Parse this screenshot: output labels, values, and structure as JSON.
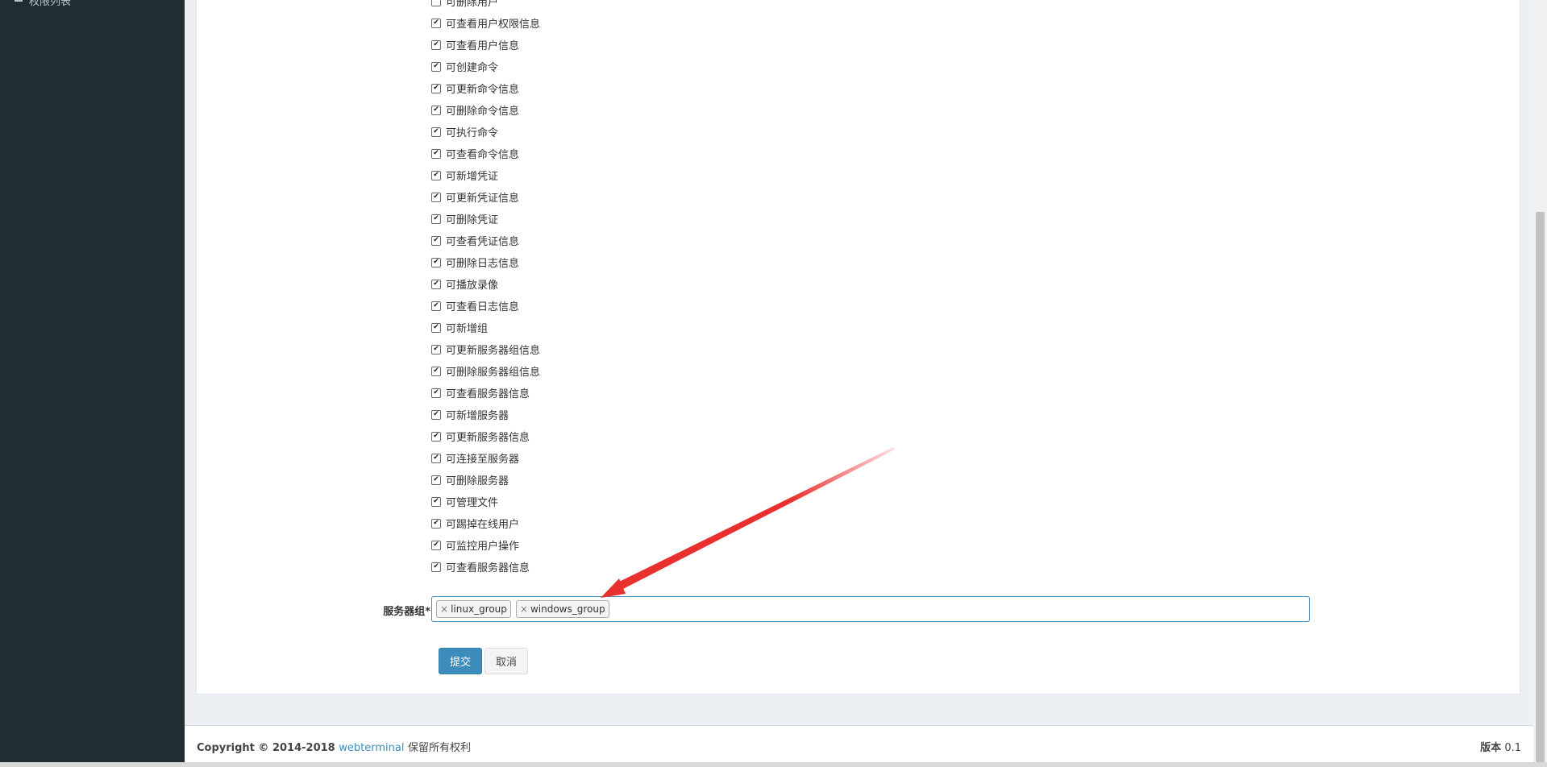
{
  "sidebar": {
    "items": [
      {
        "label": "权限列表"
      }
    ]
  },
  "permissions": [
    {
      "label": "可删除用户",
      "checked": false
    },
    {
      "label": "可查看用户权限信息",
      "checked": true
    },
    {
      "label": "可查看用户信息",
      "checked": true
    },
    {
      "label": "可创建命令",
      "checked": true
    },
    {
      "label": "可更新命令信息",
      "checked": true
    },
    {
      "label": "可删除命令信息",
      "checked": true
    },
    {
      "label": "可执行命令",
      "checked": true
    },
    {
      "label": "可查看命令信息",
      "checked": true
    },
    {
      "label": "可新增凭证",
      "checked": true
    },
    {
      "label": "可更新凭证信息",
      "checked": true
    },
    {
      "label": "可删除凭证",
      "checked": true
    },
    {
      "label": "可查看凭证信息",
      "checked": true
    },
    {
      "label": "可删除日志信息",
      "checked": true
    },
    {
      "label": "可播放录像",
      "checked": true
    },
    {
      "label": "可查看日志信息",
      "checked": true
    },
    {
      "label": "可新增组",
      "checked": true
    },
    {
      "label": "可更新服务器组信息",
      "checked": true
    },
    {
      "label": "可删除服务器组信息",
      "checked": true
    },
    {
      "label": "可查看服务器信息",
      "checked": true
    },
    {
      "label": "可新增服务器",
      "checked": true
    },
    {
      "label": "可更新服务器信息",
      "checked": true
    },
    {
      "label": "可连接至服务器",
      "checked": true
    },
    {
      "label": "可删除服务器",
      "checked": true
    },
    {
      "label": "可管理文件",
      "checked": true
    },
    {
      "label": "可踢掉在线用户",
      "checked": true
    },
    {
      "label": "可监控用户操作",
      "checked": true
    },
    {
      "label": "可查看服务器信息",
      "checked": true
    }
  ],
  "server_group": {
    "label": "服务器组*",
    "tags": [
      "linux_group",
      "windows_group"
    ],
    "remove_symbol": "×"
  },
  "actions": {
    "submit_label": "提交",
    "cancel_label": "取消"
  },
  "footer": {
    "copyright": "Copyright © 2014-2018",
    "brand": "webterminal",
    "rights": "保留所有权利",
    "version_label": "版本",
    "version_value": "0.1"
  },
  "colors": {
    "sidebar_bg": "#222d32",
    "primary": "#3c8dbc",
    "annotation_arrow": "#e8312f"
  }
}
